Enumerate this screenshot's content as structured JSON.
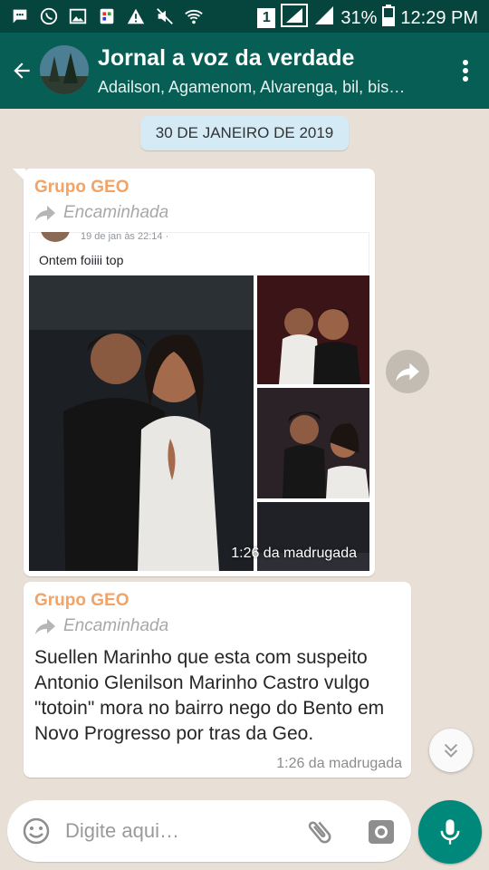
{
  "status_bar": {
    "battery": "31%",
    "time": "12:29 PM",
    "sim_slot": "1",
    "icons": [
      "chat-icon",
      "whatsapp-icon",
      "image-icon",
      "app-icon",
      "warning-icon",
      "mute-icon",
      "wifi-icon",
      "signal-icon",
      "battery-icon"
    ]
  },
  "header": {
    "title": "Jornal a voz da  verdade",
    "subtitle": "Adailson, Agamenom, Alvarenga, bil, bis…"
  },
  "chat": {
    "date_label": "30 DE JANEIRO DE 2019",
    "messages": [
      {
        "sender": "Grupo GEO",
        "forwarded_label": "Encaminhada",
        "post_meta": "19 de jan às 22:14 · ",
        "post_text": "Ontem foiiii top",
        "time": "1:26 da madrugada"
      },
      {
        "sender": "Grupo GEO",
        "forwarded_label": "Encaminhada",
        "text": "Suellen Marinho que esta com suspeito Antonio Glenilson Marinho Castro vulgo \"totoin\" mora no bairro nego do Bento em Novo Progresso por tras da Geo.",
        "time": "1:26 da madrugada"
      }
    ]
  },
  "input": {
    "placeholder": "Digite aqui…"
  },
  "colors": {
    "toolbar": "#075e54",
    "status_bar": "#05453d",
    "accent": "#00897b",
    "sender": "#f2a366",
    "date_chip": "#d4eaf4"
  }
}
